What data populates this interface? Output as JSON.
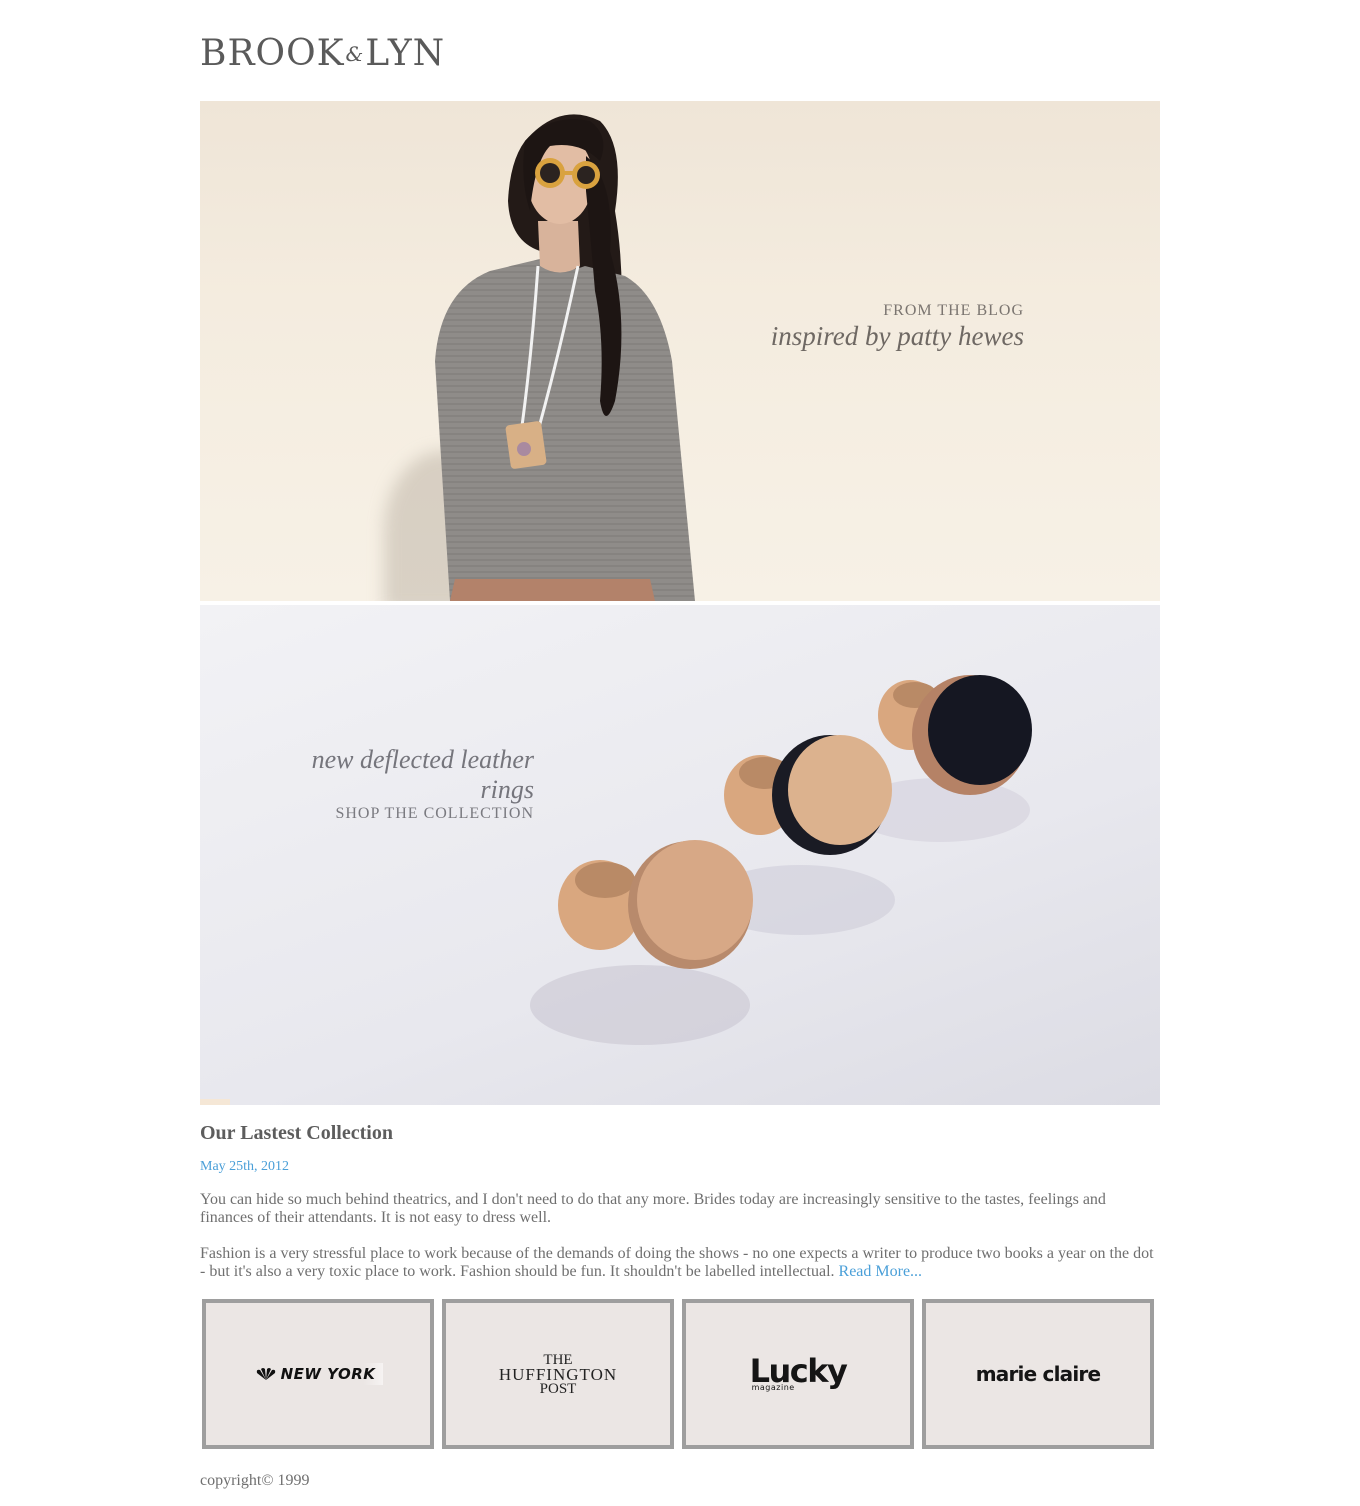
{
  "logo": {
    "left": "BROOK",
    "amp": "&",
    "right": "LYN"
  },
  "banner_blog": {
    "kicker": "FROM THE BLOG",
    "headline": "inspired by patty hewes"
  },
  "banner_rings": {
    "headline": "new deflected leather rings",
    "kicker": "SHOP THE COLLECTION"
  },
  "article": {
    "title": "Our Lastest Collection",
    "date": "May 25th, 2012",
    "paragraph1": "You can hide so much behind theatrics, and I don't need to do that any more. Brides today are increasingly sensitive to the tastes, feelings and finances of their attendants. It is not easy to dress well.",
    "paragraph2": "Fashion is a very stressful place to work because of the demands of doing the shows - no one expects a writer to produce two books a year on the dot - but it's also a very toxic place to work. Fashion should be fun. It shouldn't be labelled intellectual.",
    "read_more": "Read More..."
  },
  "press": {
    "nbc": "NEW YORK",
    "huff_line1": "THE",
    "huff_line2": "HUFFINGTON",
    "huff_line3": "POST",
    "lucky_main": "Lucky",
    "lucky_sub": "magazine",
    "marie": "marie claire"
  },
  "footer": {
    "copyright": "copyright© 1999"
  },
  "colors": {
    "accent": "#4a9fd8",
    "text": "#6f6f6f",
    "box_border": "#9e9e9e",
    "box_bg": "#ebe6e4"
  }
}
